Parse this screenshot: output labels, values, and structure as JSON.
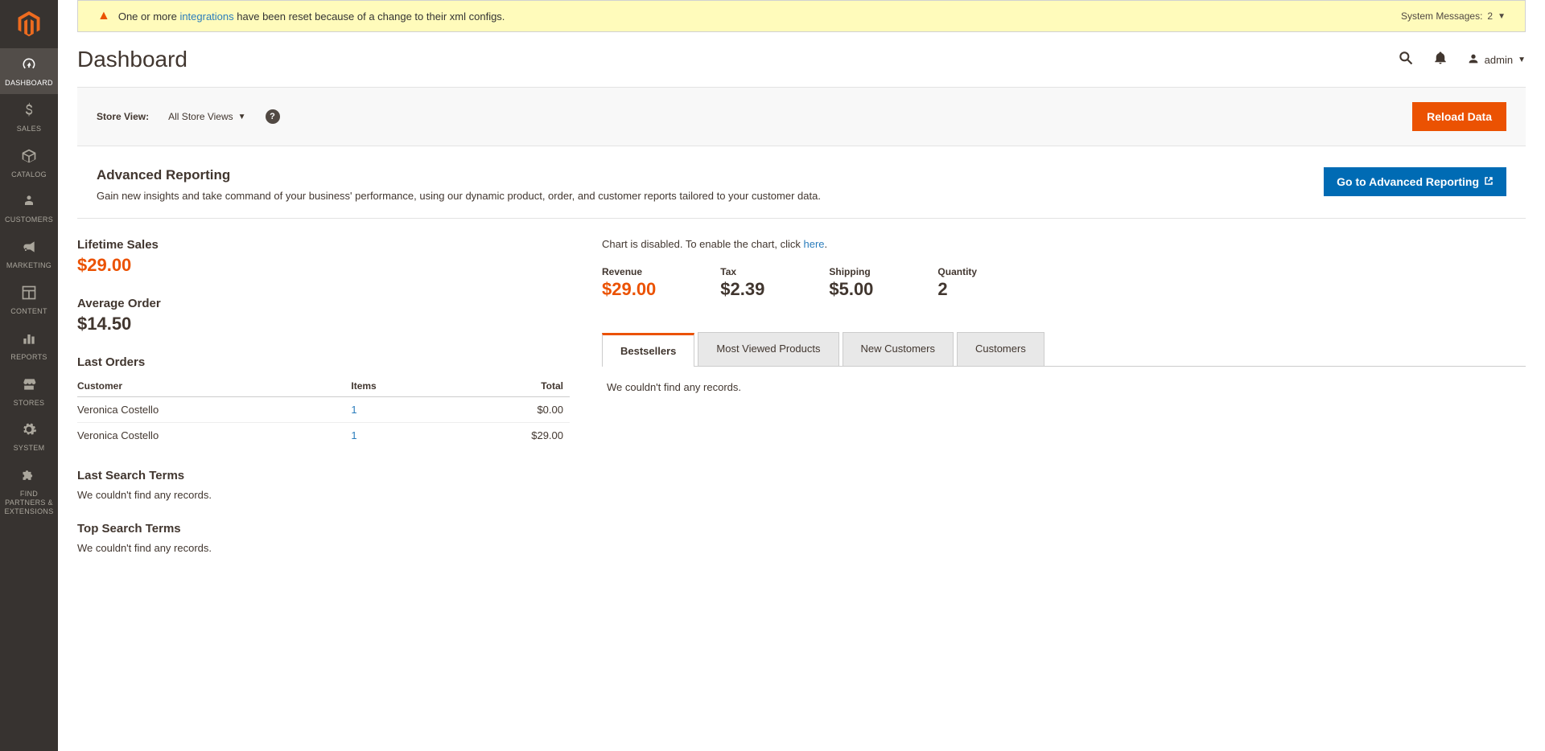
{
  "sidebar": {
    "items": [
      {
        "label": "DASHBOARD"
      },
      {
        "label": "SALES"
      },
      {
        "label": "CATALOG"
      },
      {
        "label": "CUSTOMERS"
      },
      {
        "label": "MARKETING"
      },
      {
        "label": "CONTENT"
      },
      {
        "label": "REPORTS"
      },
      {
        "label": "STORES"
      },
      {
        "label": "SYSTEM"
      },
      {
        "label": "FIND PARTNERS & EXTENSIONS"
      }
    ]
  },
  "sys_message": {
    "text_before": "One or more ",
    "link": "integrations",
    "text_after": " have been reset because of a change to their xml configs.",
    "right_label": "System Messages:",
    "count": "2"
  },
  "header": {
    "title": "Dashboard",
    "username": "admin"
  },
  "store_bar": {
    "label": "Store View:",
    "selected": "All Store Views",
    "reload_btn": "Reload Data"
  },
  "adv_report": {
    "title": "Advanced Reporting",
    "desc": "Gain new insights and take command of your business' performance, using our dynamic product, order, and customer reports tailored to your customer data.",
    "btn": "Go to Advanced Reporting"
  },
  "lifetime": {
    "title": "Lifetime Sales",
    "value": "$29.00"
  },
  "avg_order": {
    "title": "Average Order",
    "value": "$14.50"
  },
  "last_orders": {
    "title": "Last Orders",
    "cols": [
      "Customer",
      "Items",
      "Total"
    ],
    "rows": [
      {
        "customer": "Veronica Costello",
        "items": "1",
        "total": "$0.00"
      },
      {
        "customer": "Veronica Costello",
        "items": "1",
        "total": "$29.00"
      }
    ]
  },
  "last_search": {
    "title": "Last Search Terms",
    "empty": "We couldn't find any records."
  },
  "top_search": {
    "title": "Top Search Terms",
    "empty": "We couldn't find any records."
  },
  "chart_disabled": {
    "text_before": "Chart is disabled. To enable the chart, click ",
    "link": "here",
    "text_after": "."
  },
  "metrics": {
    "revenue": {
      "label": "Revenue",
      "value": "$29.00"
    },
    "tax": {
      "label": "Tax",
      "value": "$2.39"
    },
    "shipping": {
      "label": "Shipping",
      "value": "$5.00"
    },
    "quantity": {
      "label": "Quantity",
      "value": "2"
    }
  },
  "tabs": {
    "items": [
      "Bestsellers",
      "Most Viewed Products",
      "New Customers",
      "Customers"
    ],
    "empty": "We couldn't find any records."
  }
}
